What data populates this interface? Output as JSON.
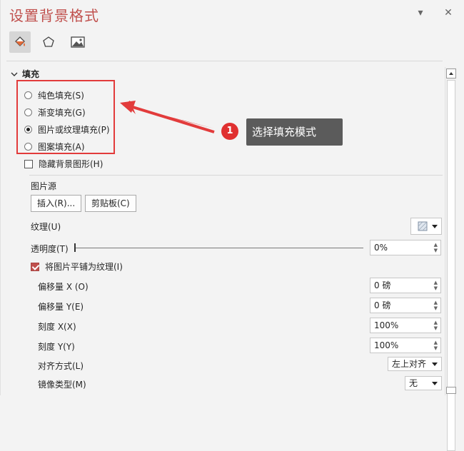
{
  "pane": {
    "title": "设置背景格式",
    "controls": {
      "menu_glyph": "▾",
      "close_glyph": "✕"
    }
  },
  "tabs": [
    {
      "name": "fill-line",
      "icon": "paint-bucket-icon",
      "active": true
    },
    {
      "name": "effects",
      "icon": "pentagon-icon",
      "active": false
    },
    {
      "name": "picture",
      "icon": "picture-icon",
      "active": false
    }
  ],
  "fill": {
    "section_label": "填充",
    "options": [
      {
        "label": "纯色填充(S)",
        "selected": false
      },
      {
        "label": "渐变填充(G)",
        "selected": false
      },
      {
        "label": "图片或纹理填充(P)",
        "selected": true
      },
      {
        "label": "图案填充(A)",
        "selected": false
      }
    ],
    "hide_bg_label": "隐藏背景图形(H)",
    "hide_bg_checked": false,
    "picture_source_label": "图片源",
    "insert_button": "插入(R)...",
    "clipboard_button": "剪贴板(C)",
    "texture_label": "纹理(U)",
    "transparency_label": "透明度(T)",
    "transparency_value": "0%",
    "transparency_fraction": 0,
    "tile_label": "将图片平铺为纹理(I)",
    "tile_checked": true,
    "offset_x_label": "偏移量 X (O)",
    "offset_x_value": "0 磅",
    "offset_y_label": "偏移量 Y(E)",
    "offset_y_value": "0 磅",
    "scale_x_label": "刻度 X(X)",
    "scale_x_value": "100%",
    "scale_y_label": "刻度 Y(Y)",
    "scale_y_value": "100%",
    "align_label": "对齐方式(L)",
    "align_value": "左上对齐",
    "mirror_label": "镜像类型(M)",
    "mirror_value": "无"
  },
  "annotation": {
    "step_number": "1",
    "callout_text": "选择填充模式",
    "color": "#e23b3b"
  }
}
